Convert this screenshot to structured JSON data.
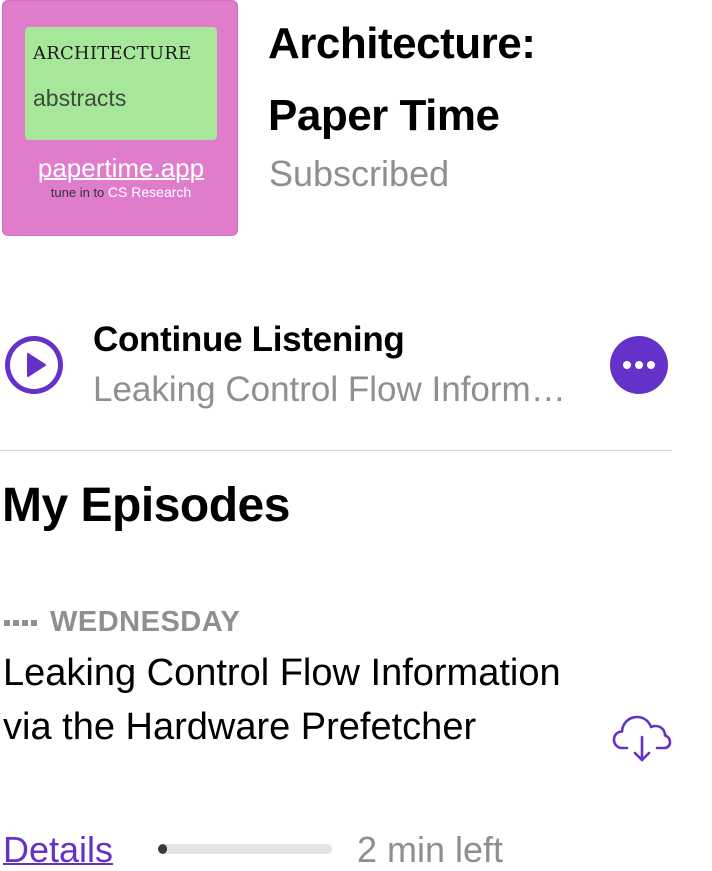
{
  "podcast": {
    "artwork": {
      "title": "ARCHITECTURE",
      "subtitle": "abstracts",
      "url": "papertime.app",
      "tagline_prefix": "tune in to",
      "tagline_highlight": "CS Research",
      "background_color": "#e07ccc",
      "panel_color": "#a6e79a"
    },
    "title_line1": "Architecture:",
    "title_line2": "Paper Time",
    "status": "Subscribed"
  },
  "continue_listening": {
    "play_icon": "play-icon",
    "title": "Continue Listening",
    "subtitle": "Leaking Control Flow Information via the Hardware Prefetcher",
    "more_icon": "ellipsis-icon"
  },
  "my_episodes": {
    "section_title": "My Episodes",
    "episodes": [
      {
        "status_icon": "partially-played-dots-icon",
        "day": "WEDNESDAY",
        "title": "Leaking Control Flow Information via the Hardware Prefetcher",
        "download_icon": "cloud-download-icon",
        "details_label": "Details",
        "progress_fraction": 0.05,
        "time_left": "2 min left"
      }
    ]
  },
  "colors": {
    "accent": "#6532c9",
    "secondary_text": "#8e8e93"
  }
}
